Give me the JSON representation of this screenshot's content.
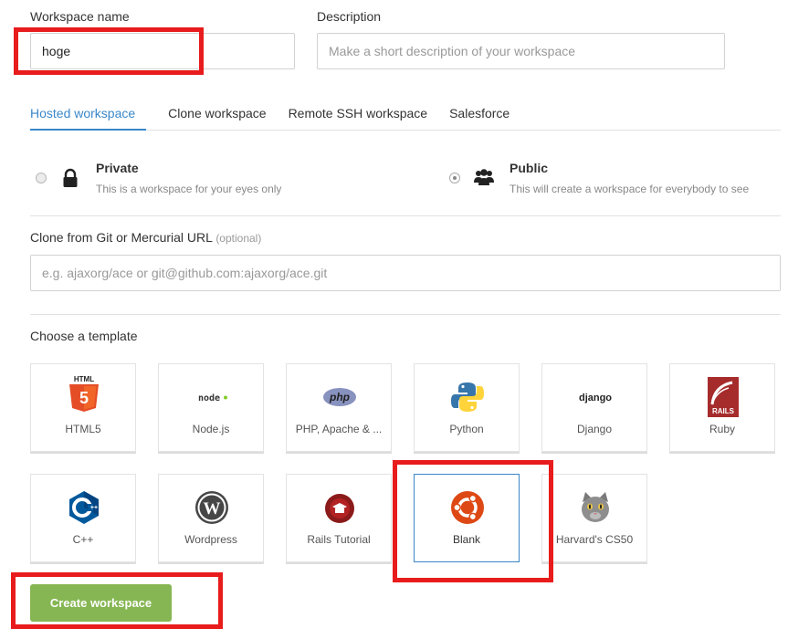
{
  "workspace_name": {
    "label": "Workspace name",
    "value": "hoge"
  },
  "description": {
    "label": "Description",
    "placeholder": "Make a short description of your workspace"
  },
  "tabs": [
    {
      "label": "Hosted workspace",
      "active": true
    },
    {
      "label": "Clone workspace",
      "active": false
    },
    {
      "label": "Remote SSH workspace",
      "active": false
    },
    {
      "label": "Salesforce",
      "active": false
    }
  ],
  "visibility": {
    "private": {
      "title": "Private",
      "subtitle": "This is a workspace for your eyes only",
      "selected": false
    },
    "public": {
      "title": "Public",
      "subtitle": "This will create a workspace for everybody to see",
      "selected": true
    }
  },
  "clone": {
    "label": "Clone from Git or Mercurial URL",
    "optional": "(optional)",
    "placeholder": "e.g. ajaxorg/ace or git@github.com:ajaxorg/ace.git"
  },
  "templates_heading": "Choose a template",
  "templates": [
    {
      "label": "HTML5",
      "icon": "html5-icon"
    },
    {
      "label": "Node.js",
      "icon": "nodejs-icon",
      "logo_text": "node"
    },
    {
      "label": "PHP, Apache & ...",
      "icon": "php-icon",
      "logo_text": "php"
    },
    {
      "label": "Python",
      "icon": "python-icon"
    },
    {
      "label": "Django",
      "icon": "django-icon",
      "logo_text": "django"
    },
    {
      "label": "Ruby",
      "icon": "rails-icon",
      "logo_text": "RAILS"
    },
    {
      "label": "C++",
      "icon": "cpp-icon"
    },
    {
      "label": "Wordpress",
      "icon": "wordpress-icon"
    },
    {
      "label": "Rails Tutorial",
      "icon": "rails-tutorial-icon"
    },
    {
      "label": "Blank",
      "icon": "ubuntu-icon",
      "selected": true
    },
    {
      "label": "Harvard's CS50",
      "icon": "cat-icon"
    }
  ],
  "create_button": "Create workspace",
  "colors": {
    "accent": "#3a87c8",
    "create_button": "#86b653",
    "annotation_red": "#e81c1c"
  }
}
